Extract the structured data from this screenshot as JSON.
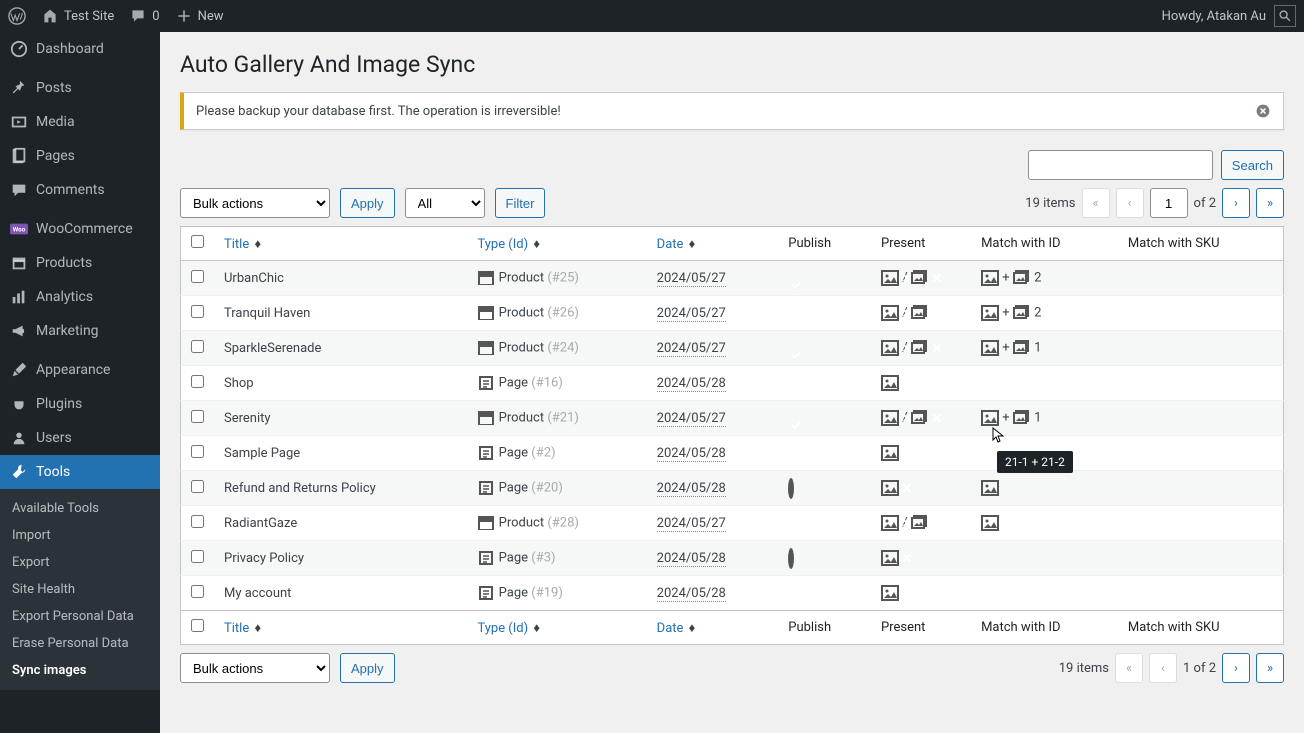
{
  "toolbar": {
    "site": "Test Site",
    "comments": "0",
    "new": "New",
    "howdy": "Howdy, Atakan Au"
  },
  "sidebar": {
    "items": [
      {
        "label": "Dashboard",
        "icon": "dashboard"
      },
      {
        "label": "Posts",
        "icon": "pin"
      },
      {
        "label": "Media",
        "icon": "media"
      },
      {
        "label": "Pages",
        "icon": "page"
      },
      {
        "label": "Comments",
        "icon": "comment"
      },
      {
        "label": "WooCommerce",
        "icon": "woo"
      },
      {
        "label": "Products",
        "icon": "archive"
      },
      {
        "label": "Analytics",
        "icon": "bar"
      },
      {
        "label": "Marketing",
        "icon": "megaphone"
      },
      {
        "label": "Appearance",
        "icon": "brush"
      },
      {
        "label": "Plugins",
        "icon": "plug"
      },
      {
        "label": "Users",
        "icon": "user"
      },
      {
        "label": "Tools",
        "icon": "wrench",
        "current": true
      }
    ],
    "submenu": [
      {
        "label": "Available Tools"
      },
      {
        "label": "Import"
      },
      {
        "label": "Export"
      },
      {
        "label": "Site Health"
      },
      {
        "label": "Export Personal Data"
      },
      {
        "label": "Erase Personal Data"
      },
      {
        "label": "Sync images",
        "current": true
      }
    ]
  },
  "page": {
    "title": "Auto Gallery And Image Sync",
    "notice": "Please backup your database first. The operation is irreversible!",
    "bulk_label": "Bulk actions",
    "apply": "Apply",
    "all": "All",
    "filter": "Filter",
    "search": "Search",
    "items_count": "19 items",
    "page_input": "1",
    "page_text_top": "of 2",
    "page_text_bottom": "1 of 2"
  },
  "columns": {
    "title": "Title",
    "type": "Type (Id)",
    "date": "Date",
    "publish": "Publish",
    "present": "Present",
    "match_id": "Match with ID",
    "match_sku": "Match with SKU"
  },
  "rows": [
    {
      "title": "UrbanChic",
      "type": "Product",
      "id": "#25",
      "date": "2024/05/27",
      "publish": "check",
      "present": "both",
      "match": "2"
    },
    {
      "title": "Tranquil Haven",
      "type": "Product",
      "id": "#26",
      "date": "2024/05/27",
      "publish": "check",
      "present": "both",
      "match": "2"
    },
    {
      "title": "SparkleSerenade",
      "type": "Product",
      "id": "#24",
      "date": "2024/05/27",
      "publish": "check",
      "present": "both",
      "match": "1"
    },
    {
      "title": "Shop",
      "type": "Page",
      "id": "#16",
      "date": "2024/05/28",
      "publish": "check",
      "present": "img",
      "match": ""
    },
    {
      "title": "Serenity",
      "type": "Product",
      "id": "#21",
      "date": "2024/05/27",
      "publish": "check",
      "present": "both",
      "match": "1"
    },
    {
      "title": "Sample Page",
      "type": "Page",
      "id": "#2",
      "date": "2024/05/28",
      "publish": "check",
      "present": "img",
      "match": ""
    },
    {
      "title": "Refund and Returns Policy",
      "type": "Page",
      "id": "#20",
      "date": "2024/05/28",
      "publish": "o",
      "present": "img",
      "match": "imgonly"
    },
    {
      "title": "RadiantGaze",
      "type": "Product",
      "id": "#28",
      "date": "2024/05/27",
      "publish": "check",
      "present": "both",
      "match": "imgonly"
    },
    {
      "title": "Privacy Policy",
      "type": "Page",
      "id": "#3",
      "date": "2024/05/28",
      "publish": "o",
      "present": "img",
      "match": ""
    },
    {
      "title": "My account",
      "type": "Page",
      "id": "#19",
      "date": "2024/05/28",
      "publish": "check",
      "present": "img",
      "match": ""
    }
  ],
  "tooltip": "21-1 + 21-2"
}
